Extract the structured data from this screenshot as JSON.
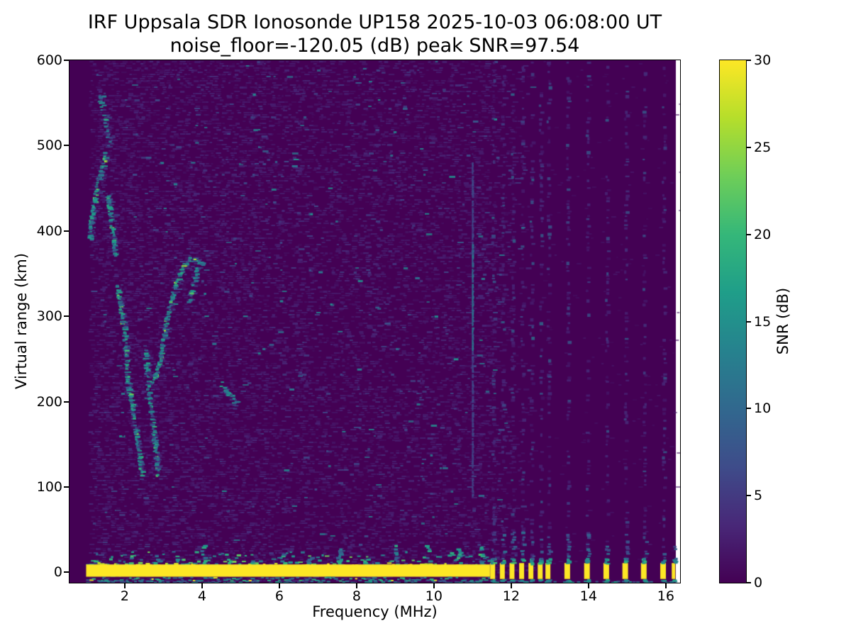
{
  "chart_data": {
    "type": "heatmap",
    "title": "IRF Uppsala SDR Ionosonde UP158 2025-10-03 06:08:00  UT",
    "subtitle": "noise_floor=-120.05 (dB) peak SNR=97.54",
    "xlabel": "Frequency (MHz)",
    "ylabel": "Virtual range (km)",
    "x_range_mhz": [
      0.57,
      16.37
    ],
    "y_range_km": [
      -12.2,
      600
    ],
    "xticks": [
      2,
      4,
      6,
      8,
      10,
      12,
      14,
      16
    ],
    "yticks": [
      0,
      100,
      200,
      300,
      400,
      500,
      600
    ],
    "grid": false,
    "noise_floor_db": -120.05,
    "peak_snr_db": 97.54,
    "colormap": "viridis",
    "colormap_stops": [
      "#440154",
      "#482878",
      "#3e4c8a",
      "#31688e",
      "#26828e",
      "#1f9e89",
      "#35b779",
      "#6ece58",
      "#b5de2b",
      "#fde725"
    ],
    "background_color": "#440154",
    "ground_band_color": "#fde725",
    "trace_color": "#1f9e89",
    "colorbar": {
      "label": "SNR (dB)",
      "min": 0,
      "max": 30,
      "ticks": [
        0,
        5,
        10,
        15,
        20,
        25,
        30
      ],
      "position": "right"
    },
    "features": {
      "data_freq_start_mhz": 1.0,
      "data_freq_end_mhz": 16.26,
      "ground_pulse_band": {
        "freq_start_mhz": 1.0,
        "freq_end_mhz": 11.45,
        "range_km": 0,
        "thickness_km": 14,
        "snr_db": 30
      },
      "pulse_bars_mhz": [
        11.52,
        11.77,
        12.02,
        12.27,
        12.51,
        12.75,
        12.95,
        13.45,
        13.96,
        14.46,
        14.95,
        15.43,
        15.93,
        16.2
      ],
      "stripe_columns_mhz": [
        11.52,
        11.77,
        12.02,
        12.27,
        12.51,
        12.75,
        12.95,
        13.45,
        13.96,
        14.46,
        14.95,
        15.43,
        15.93
      ],
      "interference_line": {
        "freq_mhz": 11.0,
        "range_km_min": 90,
        "range_km_max": 481,
        "bright_km_min": 260,
        "bright_km_max": 385,
        "snr_db": 10
      },
      "echo_traces": [
        {
          "name": "low-freq tail",
          "points": [
            [
              1.1,
              392
            ],
            [
              1.16,
              421
            ],
            [
              1.3,
              455
            ],
            [
              1.52,
              492
            ]
          ],
          "intensity": 1.0
        },
        {
          "name": "second hop",
          "points": [
            [
              1.35,
              560
            ],
            [
              1.45,
              540
            ],
            [
              1.55,
              518
            ],
            [
              1.62,
              500
            ]
          ],
          "intensity": 0.55
        },
        {
          "name": "descending leg",
          "points": [
            [
              1.56,
              442
            ],
            [
              1.62,
              425
            ],
            [
              1.7,
              398
            ],
            [
              1.76,
              372
            ]
          ],
          "intensity": 0.9
        },
        {
          "name": "E-region descent",
          "points": [
            [
              1.8,
              340
            ],
            [
              1.9,
              308
            ],
            [
              1.99,
              284
            ],
            [
              2.04,
              252
            ],
            [
              2.1,
              218
            ],
            [
              2.21,
              193
            ],
            [
              2.3,
              164
            ],
            [
              2.39,
              135
            ],
            [
              2.47,
              113
            ]
          ],
          "intensity": 1.0
        },
        {
          "name": "E-region descent 2",
          "points": [
            [
              2.52,
              262
            ],
            [
              2.6,
              222
            ],
            [
              2.67,
              193
            ],
            [
              2.74,
              166
            ],
            [
              2.81,
              138
            ],
            [
              2.87,
              112
            ]
          ],
          "intensity": 0.8
        },
        {
          "name": "F cusp rise",
          "points": [
            [
              2.77,
              225
            ],
            [
              2.95,
              258
            ],
            [
              3.1,
              300
            ],
            [
              3.3,
              335
            ],
            [
              3.5,
              358
            ],
            [
              3.7,
              368
            ],
            [
              3.9,
              366
            ],
            [
              4.05,
              360
            ]
          ],
          "intensity": 1.0
        },
        {
          "name": "F branch",
          "points": [
            [
              3.67,
              318
            ],
            [
              3.78,
              338
            ],
            [
              3.9,
              358
            ]
          ],
          "intensity": 0.7
        },
        {
          "name": "segment 4.5-4.9 MHz",
          "points": [
            [
              4.5,
              222
            ],
            [
              4.7,
              210
            ],
            [
              4.9,
              198
            ]
          ],
          "intensity": 0.8
        }
      ],
      "scatter_echoes": [
        [
          1.45,
          558
        ],
        [
          1.62,
          505
        ],
        [
          5.1,
          300
        ],
        [
          5.6,
          262
        ],
        [
          6.05,
          318
        ],
        [
          6.52,
          230
        ],
        [
          7.05,
          352
        ],
        [
          7.55,
          282
        ],
        [
          8.05,
          238
        ],
        [
          8.52,
          310
        ],
        [
          8.2,
          590
        ],
        [
          8.35,
          575
        ],
        [
          5.35,
          560
        ],
        [
          9.05,
          262
        ],
        [
          9.55,
          345
        ],
        [
          10.05,
          300
        ],
        [
          10.55,
          250
        ],
        [
          2.95,
          480
        ],
        [
          3.3,
          455
        ],
        [
          4.1,
          300
        ],
        [
          4.3,
          268
        ],
        [
          4.55,
          95
        ],
        [
          3.75,
          480
        ],
        [
          6.8,
          420
        ],
        [
          7.3,
          450
        ],
        [
          9.8,
          420
        ]
      ],
      "band_fuzz_bumps_mhz": [
        2.1,
        2.8,
        3.35,
        4.0,
        4.65,
        5.3,
        6.05,
        6.75,
        7.5,
        8.2,
        9.0,
        9.8,
        10.6,
        11.2
      ]
    }
  }
}
